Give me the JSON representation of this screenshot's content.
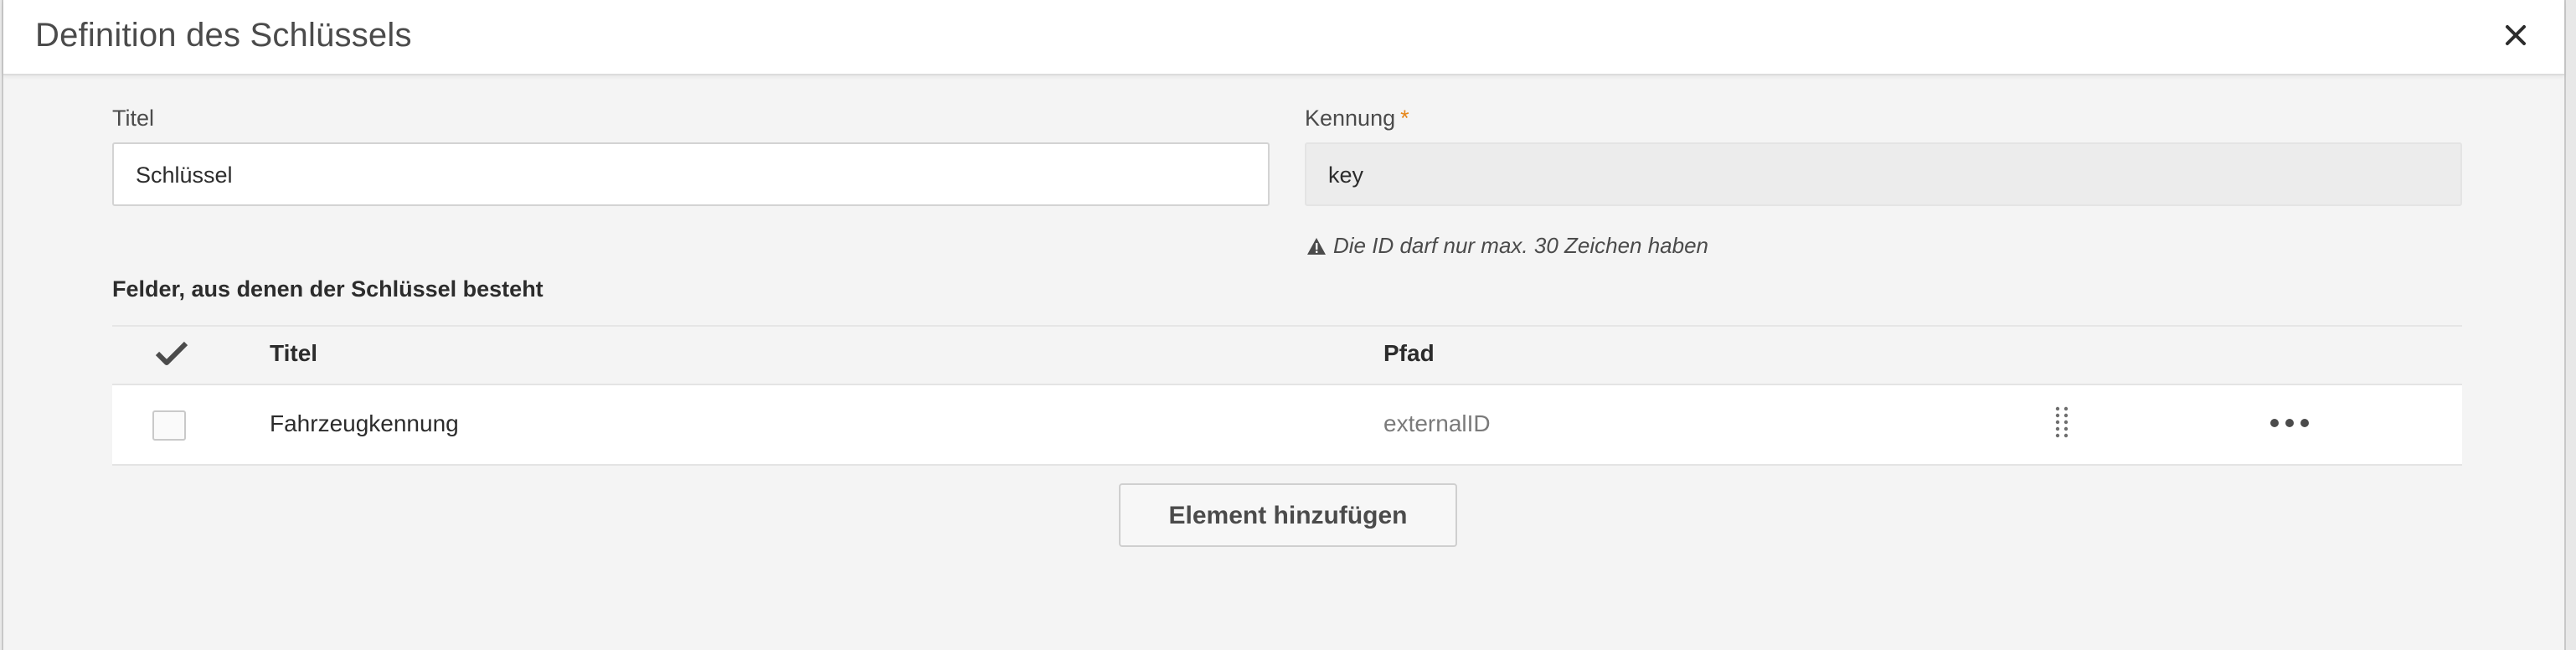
{
  "dialog": {
    "title": "Definition des Schlüssels",
    "close_icon": "close-icon"
  },
  "form": {
    "title_label": "Titel",
    "title_value": "Schlüssel",
    "id_label": "Kennung",
    "id_required_mark": "*",
    "id_value": "key",
    "id_hint": "Die ID darf nur max. 30 Zeichen haben",
    "hint_icon": "warning-icon"
  },
  "fields_section": {
    "title": "Felder, aus denen der Schlüssel besteht",
    "columns": {
      "select_icon": "checkmark-icon",
      "title": "Titel",
      "path": "Pfad"
    },
    "rows": [
      {
        "title": "Fahrzeugkennung",
        "path": "externalID",
        "drag_icon": "drag-handle-icon",
        "more_icon": "more-options-icon"
      }
    ],
    "add_button_label": "Element hinzufügen"
  },
  "colors": {
    "required_star": "#e68619",
    "background": "#f4f4f4",
    "header": "#ffffff"
  }
}
